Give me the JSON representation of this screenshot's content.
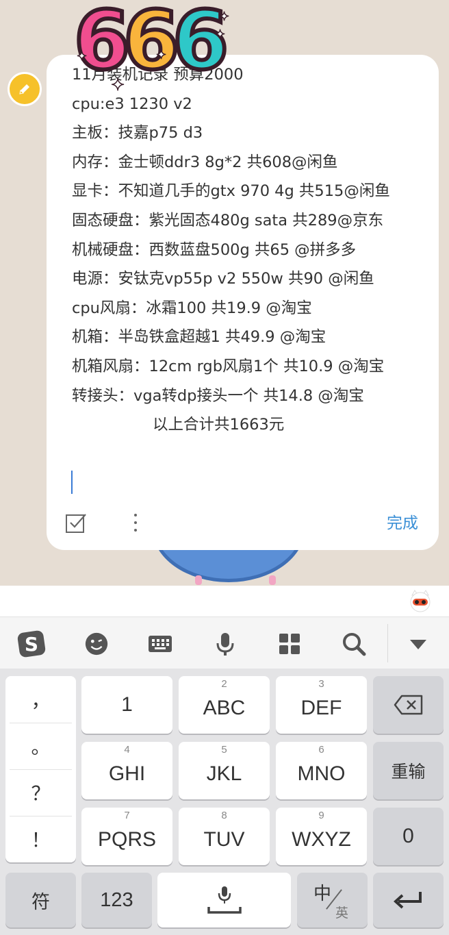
{
  "sticker": {
    "text": "666"
  },
  "note": {
    "lines": [
      "11月装机记录 预算2000",
      "cpu:e3 1230 v2",
      "主板：技嘉p75 d3",
      "内存：金士顿ddr3 8g*2 共608@闲鱼",
      "显卡：不知道几手的gtx 970 4g 共515@闲鱼",
      "固态硬盘：紫光固态480g sata 共289@京东",
      "机械硬盘：西数蓝盘500g 共65 @拼多多",
      "电源：安钛克vp55p v2 550w 共90 @闲鱼",
      "cpu风扇：冰霜100 共19.9 @淘宝",
      "机箱：半岛铁盒超越1 共49.9 @淘宝",
      "机箱风扇：12cm rgb风扇1个 共10.9 @淘宝",
      "转接头：vga转dp接头一个 共14.8 @淘宝"
    ],
    "total": "以上合计共1663元",
    "done_label": "完成"
  },
  "keyboard": {
    "toolbar": [
      "sogou-logo-icon",
      "emoji-icon",
      "keyboard-icon",
      "microphone-icon",
      "apps-grid-icon",
      "search-icon",
      "collapse-icon"
    ],
    "punctuation": [
      "，",
      "。",
      "？",
      "！"
    ],
    "rows": [
      [
        {
          "num": "",
          "label": "1"
        },
        {
          "num": "2",
          "label": "ABC"
        },
        {
          "num": "3",
          "label": "DEF"
        }
      ],
      [
        {
          "num": "4",
          "label": "GHI"
        },
        {
          "num": "5",
          "label": "JKL"
        },
        {
          "num": "6",
          "label": "MNO"
        }
      ],
      [
        {
          "num": "7",
          "label": "PQRS"
        },
        {
          "num": "8",
          "label": "TUV"
        },
        {
          "num": "9",
          "label": "WXYZ"
        }
      ]
    ],
    "reinput_label": "重输",
    "zero_label": "0",
    "symbols_label": "符",
    "numbers_label": "123",
    "lang_main": "中",
    "lang_sub": "英"
  },
  "colors": {
    "accent": "#3a8fd6",
    "badge": "#f6c12a",
    "background": "#e6ddd3"
  }
}
